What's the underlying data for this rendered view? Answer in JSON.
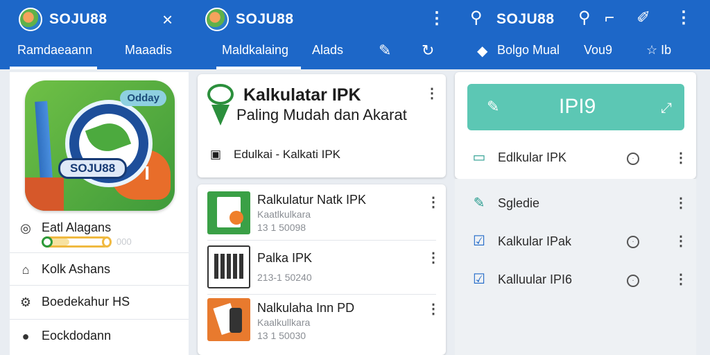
{
  "header": {
    "pane1": {
      "brand": "SOJU88",
      "close_icon": "×",
      "tabs": [
        "Ramdaeaann",
        "Maaadis"
      ]
    },
    "pane2": {
      "brand": "SOJU88",
      "menu_icon": "⋮",
      "tabs": [
        "Maldkalaing",
        "Alads"
      ]
    },
    "pane3": {
      "brand": "SOJU88",
      "tabs": [
        "Bolgo Mual",
        "Vou9"
      ],
      "star_label": "☆ Ib"
    },
    "colors": {
      "primary": "#1d67c8",
      "accent": "#5cc7b4"
    }
  },
  "left": {
    "app_badge": "Odday",
    "app_name_on_icon": "SOJU88",
    "app_icon_glyph": "I",
    "rows": [
      {
        "icon": "target-icon",
        "glyph": "◎",
        "label": "Eatl Alagans"
      },
      {
        "icon": "home-icon",
        "glyph": "⌂",
        "label": "Kolk Ashans"
      },
      {
        "icon": "settings-icon",
        "glyph": "⚙",
        "label": "Boedekahur HS"
      },
      {
        "icon": "location-icon",
        "glyph": "●",
        "label": "Eockdodann"
      }
    ],
    "progress_label": "000",
    "progress_value": 0.4
  },
  "middle": {
    "featured": {
      "title": "Kalkulatar IPK",
      "subtitle": "Paling Mudah dan Akarat",
      "category": "Edulkai - Kalkati IPK",
      "category_icon": "▣"
    },
    "list": [
      {
        "title": "Ralkulatur Natk IPK",
        "sub1": "Kaatlkulkara",
        "sub2": "13 1 50098",
        "thumb": "#3aa046"
      },
      {
        "title": "Palka IPK",
        "sub1": "",
        "sub2": "213-1 50240",
        "thumb": "#ffffff"
      },
      {
        "title": "Nalkulaha Inn PD",
        "sub1": "Kaalkullkara",
        "sub2": "13 1 50030",
        "thumb": "#e87a2e"
      }
    ]
  },
  "right": {
    "button_label": "IPI9",
    "items": [
      {
        "icon": "card-icon",
        "glyph": "▭",
        "label": "Edlkular IPK",
        "clock": true
      },
      {
        "icon": "edit-icon",
        "glyph": "✎",
        "label": "Sgledie",
        "clock": false
      },
      {
        "icon": "check-edit-icon",
        "glyph": "☑",
        "label": "Kalkular IPak",
        "clock": true
      },
      {
        "icon": "check-box-icon",
        "glyph": "☑",
        "label": "Kalluular IPI6",
        "clock": true
      }
    ]
  }
}
